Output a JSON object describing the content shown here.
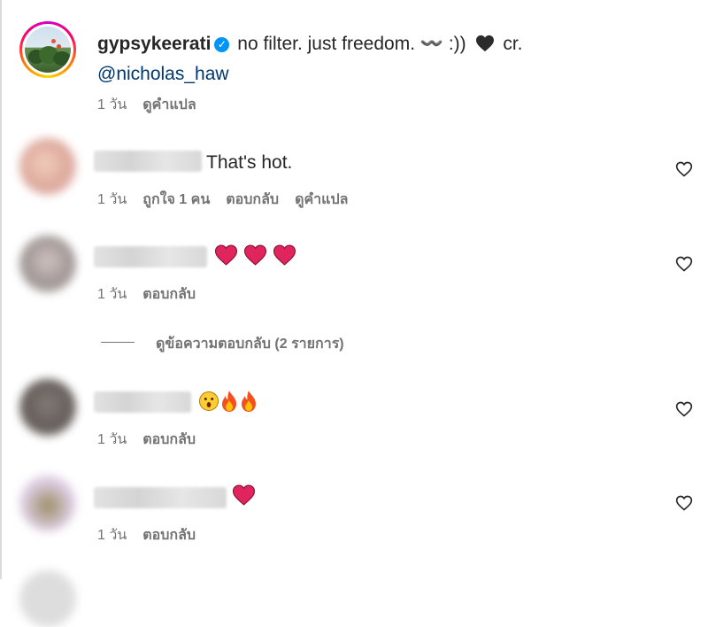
{
  "post": {
    "author": {
      "username": "gypsykeerati",
      "verified": true,
      "avatar_icon": "profile-photo-flowers-icon"
    },
    "caption_text": "no filter. just freedom. 〰️ :)) ",
    "caption_after_heart": " cr.",
    "caption_emoji_icon": "black-heart-icon",
    "mention": "@nicholas_haw",
    "time": "1 วัน",
    "translate_label": "ดูคำแปล"
  },
  "comments": [
    {
      "username_blurred": true,
      "text": "That's hot.",
      "time": "1 วัน",
      "likes_label": "ถูกใจ 1 คน",
      "reply_label": "ตอบกลับ",
      "translate_label": "ดูคำแปล",
      "emoji_icons": []
    },
    {
      "username_blurred": true,
      "text": "",
      "time": "1 วัน",
      "reply_label": "ตอบกลับ",
      "emoji_icons": [
        "red-heart-icon",
        "red-heart-icon",
        "red-heart-icon"
      ],
      "view_replies_label": "ดูข้อความตอบกลับ (2 รายการ)"
    },
    {
      "username_blurred": true,
      "text": "",
      "time": "1 วัน",
      "reply_label": "ตอบกลับ",
      "emoji_icons": [
        "astonished-face-icon",
        "fire-icon",
        "fire-icon"
      ]
    },
    {
      "username_blurred": true,
      "text": "",
      "time": "1 วัน",
      "reply_label": "ตอบกลับ",
      "emoji_icons": [
        "red-heart-icon"
      ]
    }
  ],
  "colors": {
    "accent_verified": "#0095f6",
    "mention": "#00376b",
    "meta_text": "#737373",
    "heart_red": "#e0245e"
  }
}
